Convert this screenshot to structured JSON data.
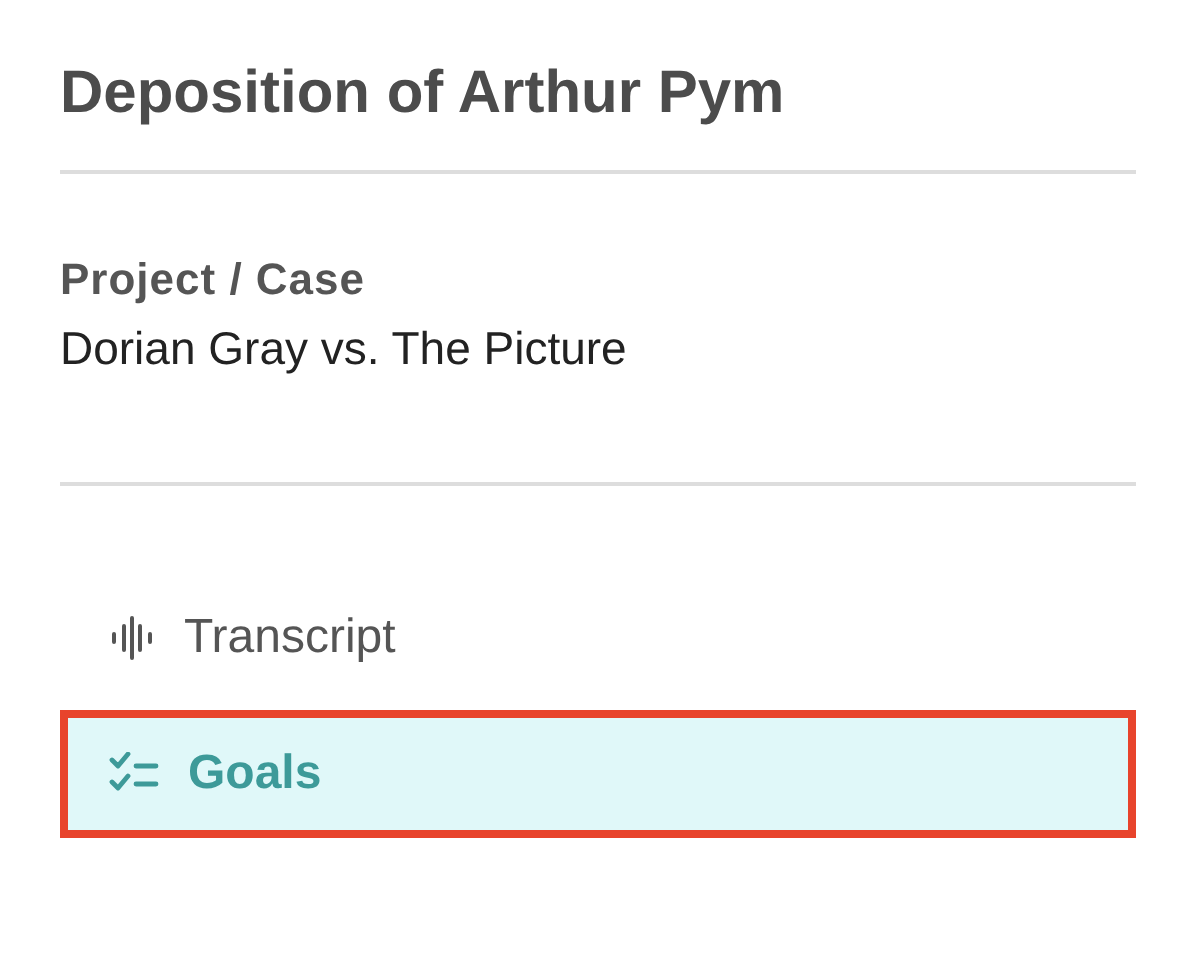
{
  "title": "Deposition of Arthur Pym",
  "project": {
    "label": "Project / Case",
    "value": "Dorian Gray vs. The Picture"
  },
  "nav": [
    {
      "label": "Transcript",
      "kind": "waveform",
      "selected": false
    },
    {
      "label": "Goals",
      "kind": "checklist",
      "selected": true
    }
  ]
}
